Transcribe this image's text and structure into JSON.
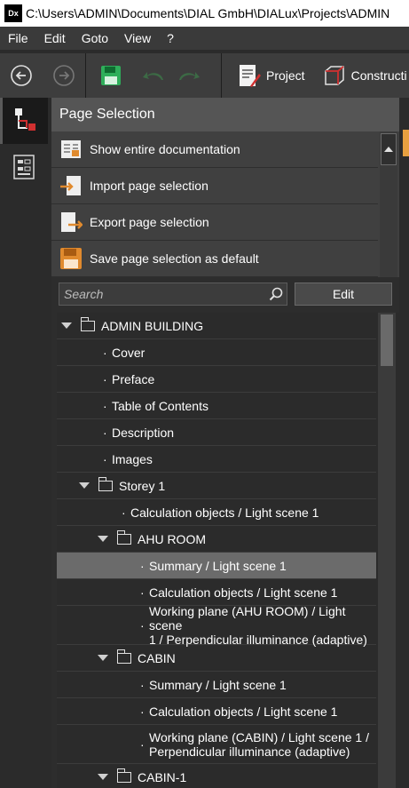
{
  "titlebar": {
    "app_icon_text": "Dx",
    "title": "C:\\Users\\ADMIN\\Documents\\DIAL GmbH\\DIALux\\Projects\\ADMIN"
  },
  "menu": [
    "File",
    "Edit",
    "Goto",
    "View",
    "?"
  ],
  "toolbar": {
    "back_icon": "back-arrow-icon",
    "forward_icon": "forward-arrow-icon",
    "save_icon": "save-icon",
    "project_label": "Project",
    "construction_label": "Constructi"
  },
  "panel": {
    "title": "Page Selection",
    "actions": [
      {
        "label": "Show entire documentation",
        "icon": "documentation-icon"
      },
      {
        "label": "Import page selection",
        "icon": "import-icon"
      },
      {
        "label": "Export page selection",
        "icon": "export-icon"
      },
      {
        "label": "Save page selection as default",
        "icon": "save-default-icon"
      }
    ],
    "search_placeholder": "Search",
    "edit_label": "Edit"
  },
  "tree": [
    {
      "label": "ADMIN BUILDING",
      "kind": "folder"
    },
    {
      "label": "Cover",
      "kind": "page"
    },
    {
      "label": "Preface",
      "kind": "page"
    },
    {
      "label": "Table of Contents",
      "kind": "page"
    },
    {
      "label": "Description",
      "kind": "page"
    },
    {
      "label": "Images",
      "kind": "page"
    },
    {
      "label": "Storey 1",
      "kind": "folder"
    },
    {
      "label": "Calculation objects / Light scene 1",
      "kind": "page"
    },
    {
      "label": "AHU ROOM",
      "kind": "folder"
    },
    {
      "label": "Summary / Light scene 1",
      "kind": "page",
      "selected": true
    },
    {
      "label": "Calculation objects / Light scene 1",
      "kind": "page"
    },
    {
      "label_line1": "Working plane (AHU ROOM) / Light scene",
      "label_line2": "1 / Perpendicular illuminance (adaptive)",
      "kind": "page"
    },
    {
      "label": "CABIN",
      "kind": "folder"
    },
    {
      "label": "Summary / Light scene 1",
      "kind": "page"
    },
    {
      "label": "Calculation objects / Light scene 1",
      "kind": "page"
    },
    {
      "label_line1": "Working plane (CABIN) / Light scene 1 /",
      "label_line2": "Perpendicular illuminance (adaptive)",
      "kind": "page"
    },
    {
      "label": "CABIN-1",
      "kind": "folder"
    }
  ],
  "colors": {
    "accent_orange": "#e8a040",
    "selected_row": "#6b6b6b",
    "panel_header": "#555555"
  }
}
